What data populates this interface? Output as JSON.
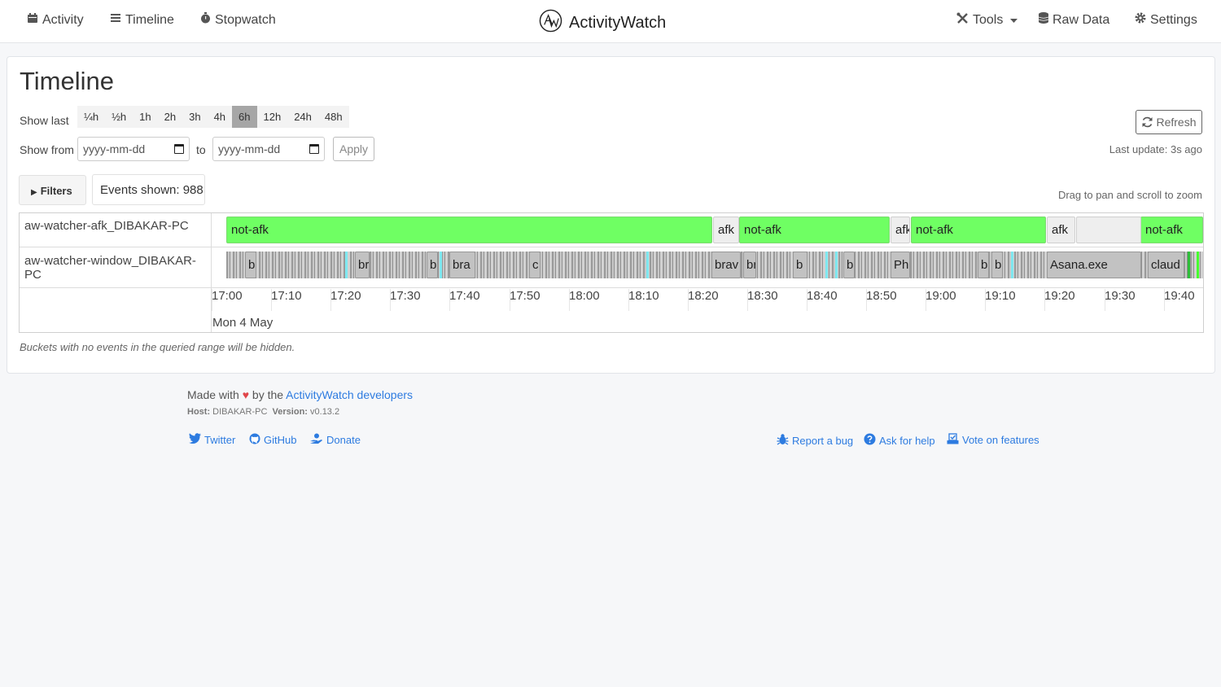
{
  "nav": {
    "activity": "Activity",
    "timeline": "Timeline",
    "stopwatch": "Stopwatch",
    "brand": "ActivityWatch",
    "tools": "Tools",
    "raw_data": "Raw Data",
    "settings": "Settings"
  },
  "page": {
    "title": "Timeline",
    "show_last_label": "Show last",
    "ranges": [
      "¼h",
      "½h",
      "1h",
      "2h",
      "3h",
      "4h",
      "6h",
      "12h",
      "24h",
      "48h"
    ],
    "active_range": "6h",
    "show_from_label": "Show from",
    "from_placeholder": "yyyy-mm-dd",
    "to_label": "to",
    "to_placeholder": "yyyy-mm-dd",
    "apply": "Apply",
    "refresh": "Refresh",
    "last_update": "Last update: 3s ago",
    "filters": "Filters",
    "events_shown": "Events shown: 988",
    "drag_hint": "Drag to pan and scroll to zoom",
    "hidden_note": "Buckets with no events in the queried range will be hidden."
  },
  "timeline": {
    "buckets": [
      "aw-watcher-afk_DIBAKAR-PC",
      "aw-watcher-window_DIBAKAR-PC"
    ],
    "ticks": [
      "17:00",
      "17:10",
      "17:20",
      "17:30",
      "17:40",
      "17:50",
      "18:00",
      "18:10",
      "18:20",
      "18:30",
      "18:40",
      "18:50",
      "19:00",
      "19:10",
      "19:20",
      "19:30",
      "19:40"
    ],
    "date_label": "Mon 4 May",
    "afk_events": [
      "not-afk",
      "afk",
      "not-afk",
      "afk",
      "not-afk",
      "afk",
      "not-afk"
    ],
    "window_events": [
      "b",
      "br",
      "b",
      "bra",
      "c",
      "brav",
      "br",
      "b",
      "b",
      "Ph",
      "b",
      "b",
      "Asana.exe",
      "claud"
    ]
  },
  "footer": {
    "made_with": "Made with",
    "by_the": "by the",
    "developers_link": "ActivityWatch developers",
    "host_label": "Host:",
    "host": "DIBAKAR-PC",
    "version_label": "Version:",
    "version": "v0.13.2",
    "twitter": "Twitter",
    "github": "GitHub",
    "donate": "Donate",
    "report_bug": "Report a bug",
    "ask_help": "Ask for help",
    "vote": "Vote on features"
  },
  "colors": {
    "not_afk": "#6fff63",
    "afk": "#eeeeee",
    "window_event": "#c2c2c2",
    "link": "#2d7be0",
    "heart": "#e0454a"
  }
}
